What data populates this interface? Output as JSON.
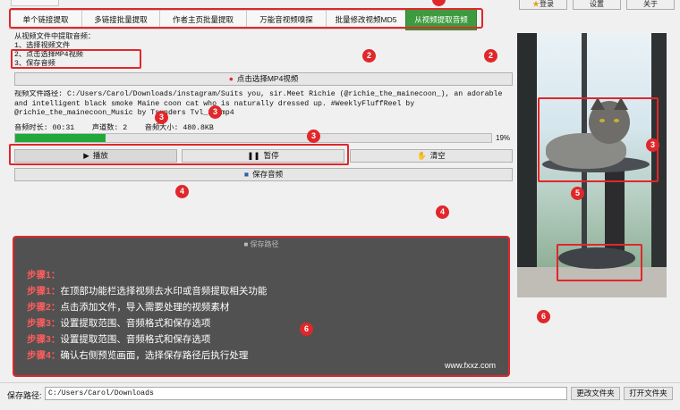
{
  "header": {
    "login_label": "登录",
    "settings_label": "设置",
    "about_label": "关于"
  },
  "tabs": [
    {
      "label": "单个链接提取"
    },
    {
      "label": "多链接批量提取"
    },
    {
      "label": "作者主页批量提取"
    },
    {
      "label": "万能音视频嗅探"
    },
    {
      "label": "批量修改视频MD5"
    },
    {
      "label": "从视频提取音频"
    }
  ],
  "panel": {
    "instructions": [
      "从视频文件中提取音频：",
      "1、选择视频文件",
      "2、点击选择MP4视频",
      "3、保存音频"
    ],
    "select_video_label": "点击选择MP4视频",
    "file_path_text": "视频文件路径: C:/Users/Carol/Downloads/instagram/Suits you, sir.Meet Richie (@richie_the_mainecoon_), an adorable and intelligent black smoke Maine coon cat who is naturally dressed up. #WeeklyFluffReel by @richie_the_mainecoon_Music by Tsunders Tvl_19.mp4",
    "duration_label": "音频时长: 00:31",
    "channels_label": "声道数: 2",
    "size_label": "音频大小: 480.8KB",
    "progress": 0.19,
    "progress_label": "19%",
    "play_label": "播放",
    "pause_label": "暂停",
    "clear_label": "清空",
    "save_audio_label": "保存音频"
  },
  "overlay": {
    "header_label": "保存路径",
    "steps": [
      {
        "key": "步骤1：",
        "text": ""
      },
      {
        "key": "步骤1：",
        "text": "在顶部功能栏选择视频去水印或音频提取相关功能"
      },
      {
        "key": "步骤2：",
        "text": "点击添加文件，导入需要处理的视频素材"
      },
      {
        "key": "步骤3：",
        "text": "设置提取范围、音频格式和保存选项"
      },
      {
        "key": "步骤3：",
        "text": "设置提取范围、音频格式和保存选项"
      },
      {
        "key": "步骤4：",
        "text": "确认右侧预览画面，选择保存路径后执行处理"
      }
    ],
    "watermark": "www.fxxz.com"
  },
  "footer": {
    "save_path_label": "保存路径:",
    "save_path_value": "C:/Users/Carol/Downloads",
    "change_folder_label": "更改文件夹",
    "open_folder_label": "打开文件夹"
  },
  "badges": [
    "2",
    "2",
    "3",
    "3",
    "3",
    "3",
    "4",
    "4",
    "5",
    "6",
    "6"
  ],
  "colors": {
    "accent_green": "#3e9a3e",
    "progress_green": "#22a83a",
    "annotation_red": "#e0272b",
    "overlay_gray": "#484848"
  }
}
